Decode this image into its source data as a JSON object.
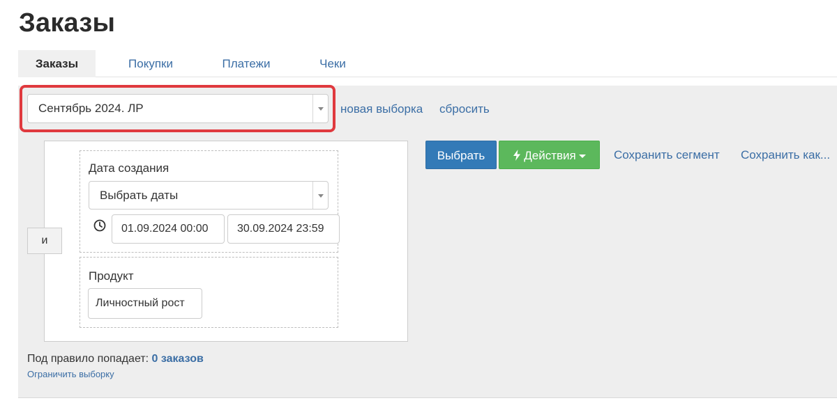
{
  "page": {
    "title": "Заказы"
  },
  "tabs": [
    {
      "label": "Заказы",
      "active": true
    },
    {
      "label": "Покупки",
      "active": false
    },
    {
      "label": "Платежи",
      "active": false
    },
    {
      "label": "Чеки",
      "active": false
    }
  ],
  "segment": {
    "selected": "Сентябрь 2024. ЛР",
    "new_selection_link": "новая выборка",
    "reset_link": "сбросить",
    "highlight_color": "#e0393e"
  },
  "actions": {
    "select_button": "Выбрать",
    "actions_button": "Действия",
    "save_segment_link": "Сохранить сегмент",
    "save_as_link": "Сохранить как..."
  },
  "rules": {
    "operator": "и",
    "created_date": {
      "label": "Дата создания",
      "select_value": "Выбрать даты",
      "from": "01.09.2024 00:00",
      "to": "30.09.2024 23:59"
    },
    "product": {
      "label": "Продукт",
      "value": "Личностный рост"
    }
  },
  "result": {
    "prefix": "Под правило попадает:",
    "count": "0 заказов",
    "limit_link": "Ограничить выборку"
  },
  "icons": {
    "clock": "clock-icon",
    "bolt": "bolt-icon",
    "dropdown": "chevron-down-icon"
  },
  "colors": {
    "primary": "#337ab7",
    "success": "#5cb85c",
    "link": "#3b6ea5"
  }
}
